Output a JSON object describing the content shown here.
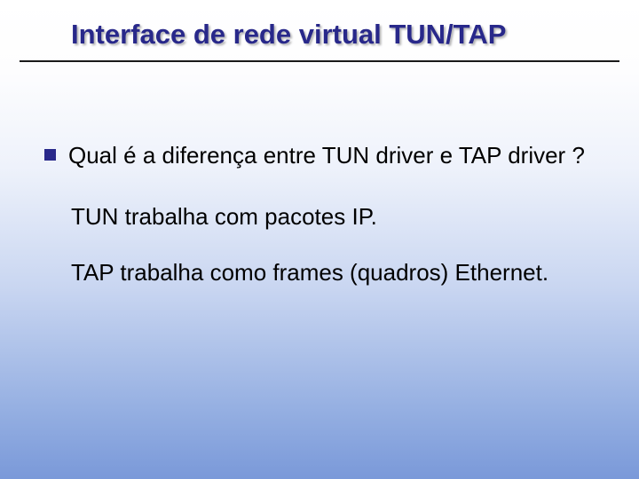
{
  "title": "Interface de rede virtual TUN/TAP",
  "bullet": "Qual é a diferença entre TUN driver e TAP driver ?",
  "line1": "TUN trabalha com pacotes IP.",
  "line2": "TAP trabalha como frames (quadros) Ethernet."
}
